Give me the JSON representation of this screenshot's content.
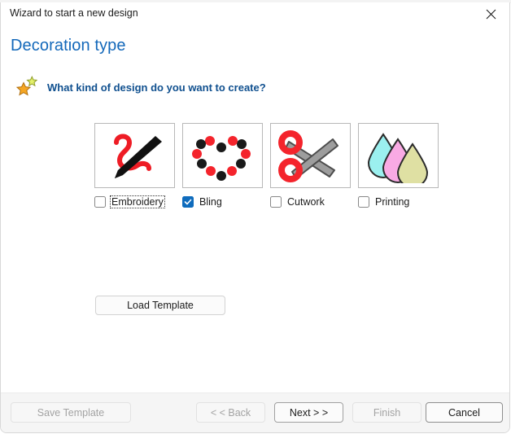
{
  "background": {
    "ghost_text": "· · · · · · · · · · · · · · · · · · · · ·"
  },
  "window": {
    "title": "Wizard to start a new design",
    "close_icon": "close-icon",
    "close_label": "Close"
  },
  "header": {
    "page_title": "Decoration type",
    "star_icon": "stars-icon",
    "question": "What kind of design do you want to create?"
  },
  "colors": {
    "accent_blue": "#0f6cbd",
    "title_blue": "#1368ba",
    "question_blue": "#10508f",
    "thread_red": "#ee1c25",
    "bling_red": "#f4242c",
    "bling_black": "#1a1a1a",
    "scissor_gray": "#9d9d9d",
    "ink_cyan": "#9bf0ef",
    "ink_pink": "#f9aae4",
    "ink_olive": "#dfe0a3",
    "footer_bg": "#f5f5f5"
  },
  "options": [
    {
      "id": "embroidery",
      "label": "Embroidery",
      "checked": false,
      "focused": true,
      "icon": "needle-and-thread-icon"
    },
    {
      "id": "bling",
      "label": "Bling",
      "checked": true,
      "focused": false,
      "icon": "rhinestone-heart-icon"
    },
    {
      "id": "cutwork",
      "label": "Cutwork",
      "checked": false,
      "focused": false,
      "icon": "scissors-icon"
    },
    {
      "id": "printing",
      "label": "Printing",
      "checked": false,
      "focused": false,
      "icon": "ink-drops-icon"
    }
  ],
  "main": {
    "load_template_label": "Load Template"
  },
  "footer": {
    "save_template_label": "Save Template",
    "save_template_disabled": true,
    "back_label": "< < Back",
    "back_disabled": true,
    "next_label": "Next > >",
    "next_disabled": false,
    "finish_label": "Finish",
    "finish_disabled": true,
    "cancel_label": "Cancel",
    "cancel_disabled": false
  }
}
